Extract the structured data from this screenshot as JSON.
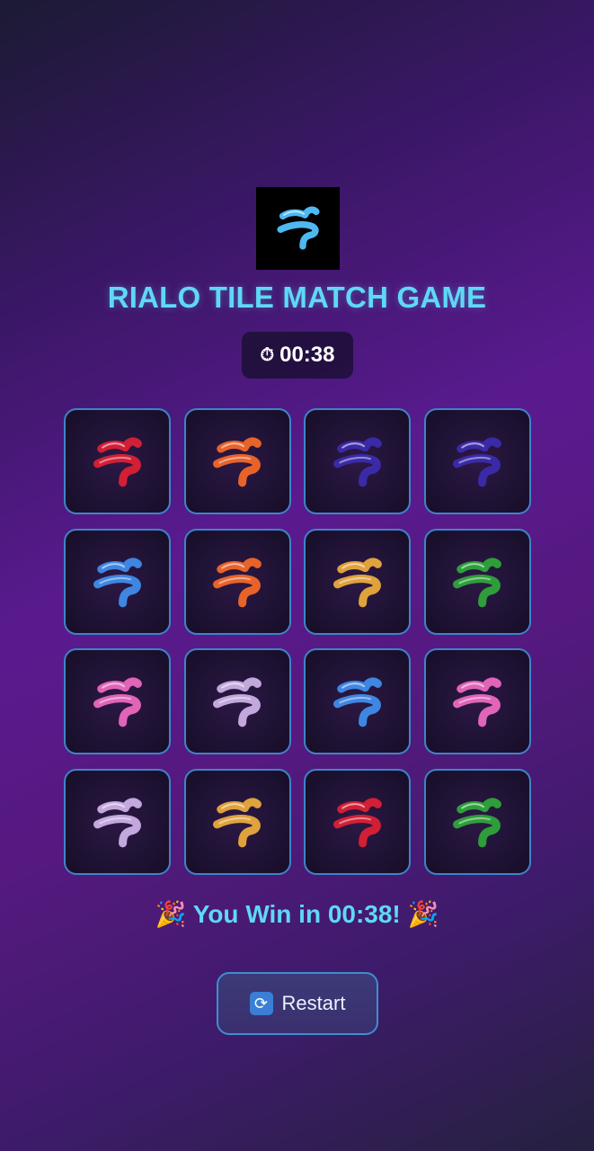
{
  "app": {
    "title": "RIALO TILE MATCH GAME",
    "logo_icon": "rialo-glyph-icon",
    "logo_color": "#4fb8f0"
  },
  "timer": {
    "icon": "stopwatch-icon",
    "icon_glyph": "⏱",
    "value": "00:38"
  },
  "board": {
    "rows": 4,
    "cols": 4,
    "tiles": [
      {
        "color": "#d21f35",
        "name": "red"
      },
      {
        "color": "#e8632a",
        "name": "orange"
      },
      {
        "color": "#3a2aa8",
        "name": "indigo"
      },
      {
        "color": "#3a2aa8",
        "name": "indigo"
      },
      {
        "color": "#3f86e2",
        "name": "blue"
      },
      {
        "color": "#e8632a",
        "name": "orange"
      },
      {
        "color": "#e0a23c",
        "name": "gold"
      },
      {
        "color": "#2e9e3a",
        "name": "green"
      },
      {
        "color": "#e064b8",
        "name": "pink"
      },
      {
        "color": "#c2a8dc",
        "name": "lavender"
      },
      {
        "color": "#3f86e2",
        "name": "blue"
      },
      {
        "color": "#e064b8",
        "name": "pink"
      },
      {
        "color": "#c2a8dc",
        "name": "lavender"
      },
      {
        "color": "#e0a23c",
        "name": "gold"
      },
      {
        "color": "#d21f35",
        "name": "red"
      },
      {
        "color": "#2e9e3a",
        "name": "green"
      }
    ]
  },
  "status": {
    "message": "🎉 You Win in 00:38! 🎉"
  },
  "restart": {
    "icon": "refresh-icon",
    "icon_glyph": "🔄",
    "label": "Restart"
  }
}
